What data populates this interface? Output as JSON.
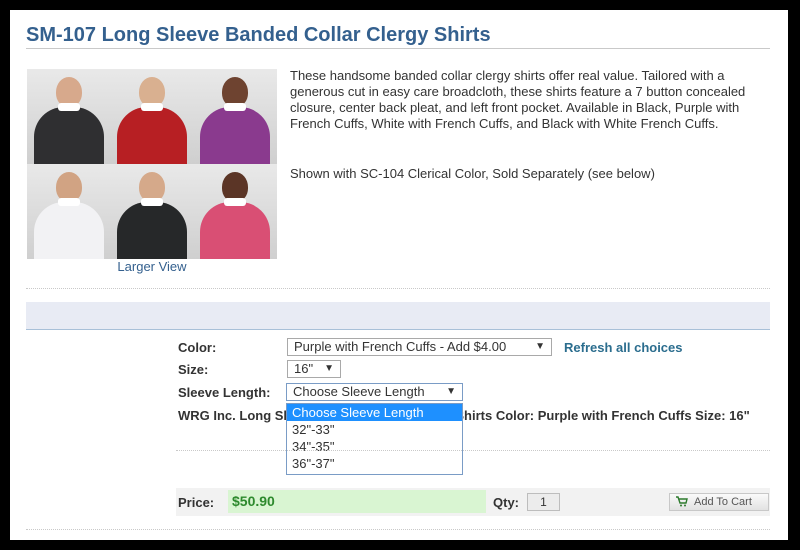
{
  "product": {
    "title": "SM-107 Long Sleeve Banded Collar Clergy Shirts",
    "description": "These handsome banded collar clergy shirts offer real value. Tailored with a generous cut in easy care broadcloth, these shirts feature a 7 button concealed closure, center back pleat, and left front pocket. Available in Black, Purple with French Cuffs, White with French Cuffs, and Black with White French Cuffs.",
    "shown_with": "Shown with SC-104 Clerical Color, Sold Separately (see below)",
    "larger_view": "Larger View",
    "photos": [
      {
        "shirt": "#2f2f31",
        "skin": "#d7a98c"
      },
      {
        "shirt": "#b71f23",
        "skin": "#d9b090"
      },
      {
        "shirt": "#8a3a8e",
        "skin": "#6e4330"
      },
      {
        "shirt": "#f2f2f4",
        "skin": "#d1a383"
      },
      {
        "shirt": "#262829",
        "skin": "#d5a98a"
      },
      {
        "shirt": "#d94f74",
        "skin": "#5b3526"
      }
    ]
  },
  "options": {
    "color_label": "Color:",
    "color_value": "Purple with French Cuffs - Add $4.00",
    "size_label": "Size:",
    "size_value": "16\"",
    "sleeve_label": "Sleeve Length:",
    "sleeve_value": "Choose Sleeve Length",
    "refresh": "Refresh all choices",
    "sleeve_options": [
      "Choose Sleeve Length",
      "32\"-33\"",
      "34\"-35\"",
      "36\"-37\""
    ],
    "configuration": "WRG Inc. Long Sleeve Banded Collar Clergy Shirts Color: Purple with French Cuffs Size: 16\""
  },
  "purchase": {
    "price_label": "Price:",
    "price": "$50.90",
    "qty_label": "Qty:",
    "qty": "1",
    "add_to_cart": "Add To Cart"
  },
  "colors": {
    "accent": "#34608e",
    "price_green": "#2d8a2d",
    "highlight": "#1e90ff"
  }
}
